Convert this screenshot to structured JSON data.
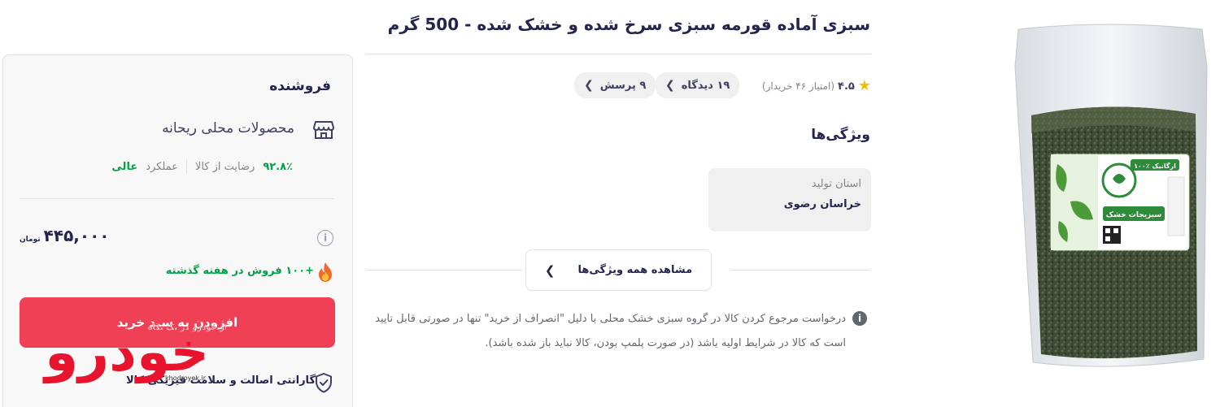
{
  "product": {
    "title": "سبزی آماده قورمه سبزی سرخ شده و خشک شده - 500 گرم",
    "rating": {
      "value": "۴.۵",
      "count_text": "(امتیاز ۴۶ خریدار)",
      "views_label": "۱۹ دیدگاه",
      "questions_label": "۹ پرسش"
    },
    "image": {
      "package_brand": "سبزیجات خشک",
      "package_tag": "۱۰۰٪ ارگانیک"
    }
  },
  "features": {
    "heading": "ویژگی‌ها",
    "items": [
      {
        "label": "استان تولید",
        "value": "خراسان رضوی"
      }
    ],
    "show_all_label": "مشاهده همه ویژگی‌ها"
  },
  "return_note": {
    "text": "درخواست مرجوع کردن کالا در گروه سبزی خشک محلی با دلیل \"انصراف از خرید\" تنها در صورتی قابل تایید است که کالا در شرایط اولیه باشد (در صورت پلمپ بودن، کالا نباید باز شده باشد)."
  },
  "seller": {
    "heading": "فروشنده",
    "name": "محصولات محلی ریحانه",
    "satisfaction_value": "۹۲.۸٪",
    "satisfaction_label": "رضایت از کالا",
    "performance_label": "عملکرد",
    "performance_value": "عالی"
  },
  "buy_box": {
    "price": "۴۴۵,۰۰۰",
    "currency": "تومان",
    "sales_note": "+۱۰۰ فروش در هفته گذشته",
    "add_to_cart_label": "افزودن به سبد خرید",
    "guarantee": "گارانتی اصالت و سلامت فیزیکی کالا"
  },
  "watermark": {
    "logo_text": "خودرو",
    "tagline": "اخبار خودرو در یک نگاه",
    "domain": "khodroyek.ir"
  },
  "colors": {
    "primary_text": "#23254e",
    "secondary_text": "#81858b",
    "accent_red": "#ef4056",
    "success_green": "#00a049",
    "star_yellow": "#f9bc00",
    "pill_bg": "#f0f0f1"
  },
  "icons": {
    "rating": "star-icon",
    "store": "store-icon",
    "info": "info-icon",
    "fire": "fire-icon",
    "shield": "shield-check-icon",
    "chevron": "chevron-left-icon"
  }
}
